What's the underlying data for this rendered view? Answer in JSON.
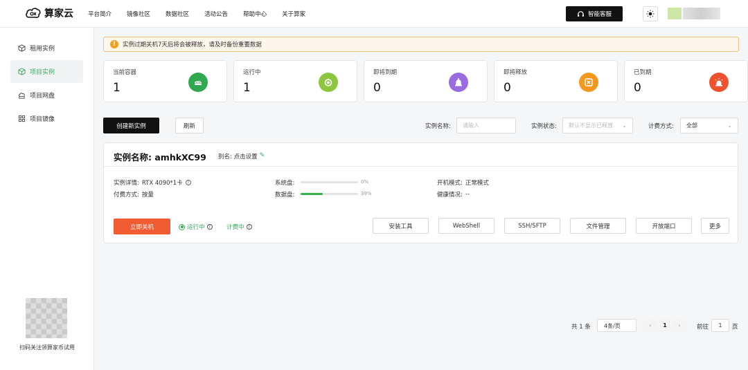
{
  "header": {
    "logo_text": "算家云",
    "nav": [
      "平台简介",
      "镜像社区",
      "数据社区",
      "活动公告",
      "帮助中心",
      "关于算家"
    ],
    "service_button": "智能客服",
    "theme_icon": "sun-icon"
  },
  "sidebar": {
    "items": [
      {
        "label": "租用实例",
        "icon": "cube-outline-icon",
        "active": false
      },
      {
        "label": "项目实例",
        "icon": "cube-icon",
        "active": true
      },
      {
        "label": "项目网盘",
        "icon": "cloud-drive-icon",
        "active": false
      },
      {
        "label": "项目镜像",
        "icon": "grid-icon",
        "active": false
      }
    ],
    "qr_caption": "扫码关注领算家币试用"
  },
  "alert": {
    "text": "实例过期关机7天后将会被释放，请及时备份重要数据"
  },
  "stats": [
    {
      "label": "当前容器",
      "value": "1",
      "color": "#2fa84f",
      "icon": "container-icon"
    },
    {
      "label": "运行中",
      "value": "1",
      "color": "#8cc63f",
      "icon": "power-icon"
    },
    {
      "label": "即将到期",
      "value": "0",
      "color": "#9a6ae0",
      "icon": "bell-icon"
    },
    {
      "label": "即将释放",
      "value": "0",
      "color": "#f39a1e",
      "icon": "release-icon"
    },
    {
      "label": "已到期",
      "value": "0",
      "color": "#f0522e",
      "icon": "alarm-icon"
    }
  ],
  "toolbar": {
    "create_label": "创建新实例",
    "refresh_label": "刷新",
    "name_label": "实例名称:",
    "name_placeholder": "请输入",
    "status_label": "实例状态:",
    "status_placeholder": "默认不显示已释放",
    "billing_label": "计费方式:",
    "billing_value": "全部"
  },
  "instance": {
    "title_prefix": "实例名称:",
    "name": "amhkXC99",
    "alias_label": "别名: 点击设置",
    "detail_label": "实例详情:",
    "detail_value": "RTX 4090*1卡",
    "billing_label": "付费方式:",
    "billing_value": "按量",
    "sys_disk_label": "系统盘:",
    "sys_disk_pct": "0%",
    "sys_disk_fraction": 0,
    "data_disk_label": "数据盘:",
    "data_disk_pct": "39%",
    "data_disk_fraction": 0.39,
    "boot_mode_label": "开机模式:",
    "boot_mode_value": "正常模式",
    "health_label": "健康情况:",
    "health_value": "--",
    "shutdown_label": "立即关机",
    "running_label": "运行中",
    "billing_status": "计费中",
    "actions": [
      "安装工具",
      "WebShell",
      "SSH/SFTP",
      "文件管理",
      "开放端口",
      "更多"
    ]
  },
  "pagination": {
    "total": "共 1 条",
    "page_size": "4条/页",
    "current_page": "1",
    "goto_label": "前往",
    "goto_value": "1",
    "page_suffix": "页"
  }
}
